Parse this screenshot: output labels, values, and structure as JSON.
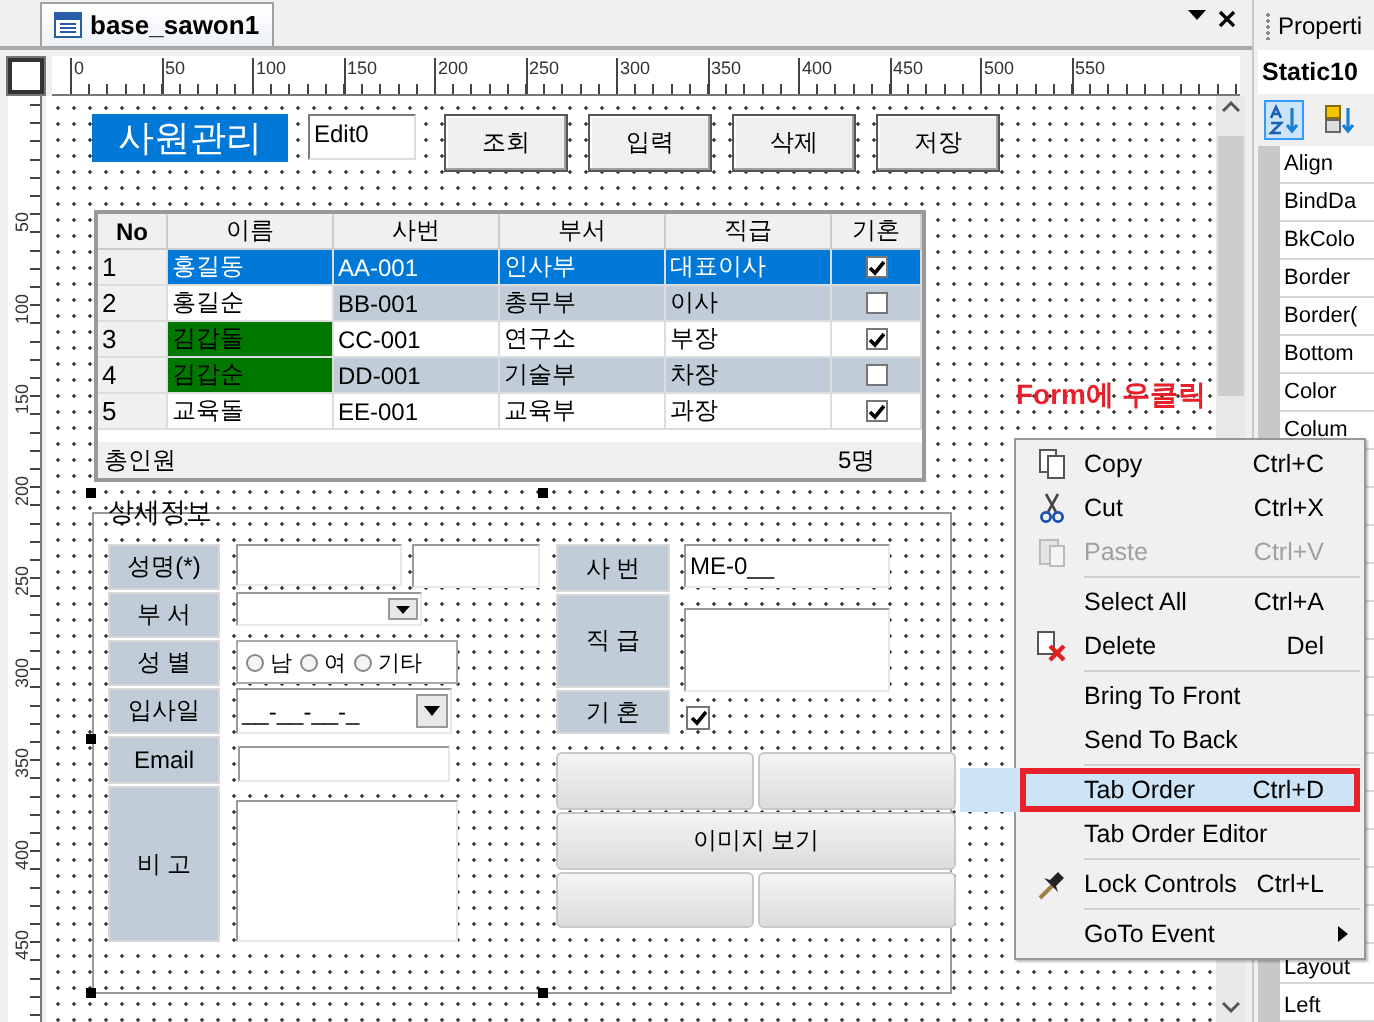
{
  "document_tab": {
    "title": "base_sawon1"
  },
  "ruler": {
    "horizontal": [
      "0",
      "50",
      "100",
      "150",
      "200",
      "250",
      "300",
      "350",
      "400",
      "450",
      "500",
      "550"
    ],
    "vertical": [
      "50",
      "100",
      "150",
      "200",
      "250",
      "300",
      "350",
      "400",
      "450"
    ]
  },
  "form": {
    "title_label": "사원관리",
    "edit": {
      "value": "Edit0"
    },
    "buttons": [
      "조회",
      "입력",
      "삭제",
      "저장"
    ],
    "grid": {
      "columns": [
        "No",
        "이름",
        "사번",
        "부서",
        "직급",
        "기혼"
      ],
      "rows": [
        {
          "no": "1",
          "name": "홍길동",
          "id": "AA-001",
          "dept": "인사부",
          "rank": "대표이사",
          "married": true,
          "selected": true
        },
        {
          "no": "2",
          "name": "홍길순",
          "id": "BB-001",
          "dept": "총무부",
          "rank": "이사",
          "married": false,
          "selected": false
        },
        {
          "no": "3",
          "name": "김갑돌",
          "id": "CC-001",
          "dept": "연구소",
          "rank": "부장",
          "married": true,
          "selected": false,
          "color": "#007800"
        },
        {
          "no": "4",
          "name": "김갑순",
          "id": "DD-001",
          "dept": "기술부",
          "rank": "차장",
          "married": false,
          "selected": false,
          "color": "#007800"
        },
        {
          "no": "5",
          "name": "교육돌",
          "id": "EE-001",
          "dept": "교육부",
          "rank": "과장",
          "married": true,
          "selected": false
        }
      ],
      "footer": {
        "label": "총인원",
        "count": "5명"
      }
    },
    "annotation": "Form에 우클릭",
    "detail": {
      "title": "상세정보",
      "left_fields": [
        {
          "label": "성명(*)",
          "kind": "double_text"
        },
        {
          "label": "부 서",
          "kind": "combo"
        },
        {
          "label": "성 별",
          "kind": "radio",
          "options": [
            {
              "label": "남",
              "selected": false
            },
            {
              "label": "여",
              "selected": false
            },
            {
              "label": "기타",
              "selected": false
            }
          ]
        },
        {
          "label": "입사일",
          "kind": "date",
          "value": "__-__-__-_"
        },
        {
          "label": "Email",
          "kind": "text"
        },
        {
          "label": "비 고",
          "kind": "textarea"
        }
      ],
      "right_fields": [
        {
          "label": "사 번",
          "kind": "text",
          "value": "ME-0__"
        },
        {
          "label": "직 급",
          "kind": "textarea"
        },
        {
          "label": "기 혼",
          "kind": "checkbox",
          "checked": true
        }
      ],
      "image_button": "이미지 보기"
    }
  },
  "context_menu": {
    "groups": [
      [
        {
          "label": "Copy",
          "shortcut": "Ctrl+C",
          "disabled": false,
          "selected": false
        },
        {
          "label": "Cut",
          "shortcut": "Ctrl+X",
          "disabled": false,
          "selected": false
        },
        {
          "label": "Paste",
          "shortcut": "Ctrl+V",
          "disabled": true,
          "selected": false
        }
      ],
      [
        {
          "label": "Select All",
          "shortcut": "Ctrl+A",
          "disabled": false,
          "selected": false
        },
        {
          "label": "Delete",
          "shortcut": "Del",
          "disabled": false,
          "selected": false
        }
      ],
      [
        {
          "label": "Bring To Front",
          "disabled": false,
          "selected": false
        },
        {
          "label": "Send To Back",
          "disabled": false,
          "selected": false
        }
      ],
      [
        {
          "label": "Tab Order",
          "shortcut": "Ctrl+D",
          "disabled": false,
          "selected": true
        },
        {
          "label": "Tab Order Editor",
          "disabled": false,
          "selected": false
        }
      ],
      [
        {
          "label": "Lock Controls",
          "shortcut": "Ctrl+L",
          "disabled": false,
          "selected": false
        }
      ],
      [
        {
          "label": "GoTo Event",
          "submenu": true,
          "disabled": false,
          "selected": false
        }
      ]
    ]
  },
  "properties": {
    "title": "Properti",
    "object": "Static10",
    "items": [
      "Align",
      "BindDa",
      "BkColo",
      "Border",
      "Border(",
      "Bottom",
      "Color",
      "Colum"
    ],
    "bottom_items": [
      "Layout",
      "Left"
    ]
  }
}
